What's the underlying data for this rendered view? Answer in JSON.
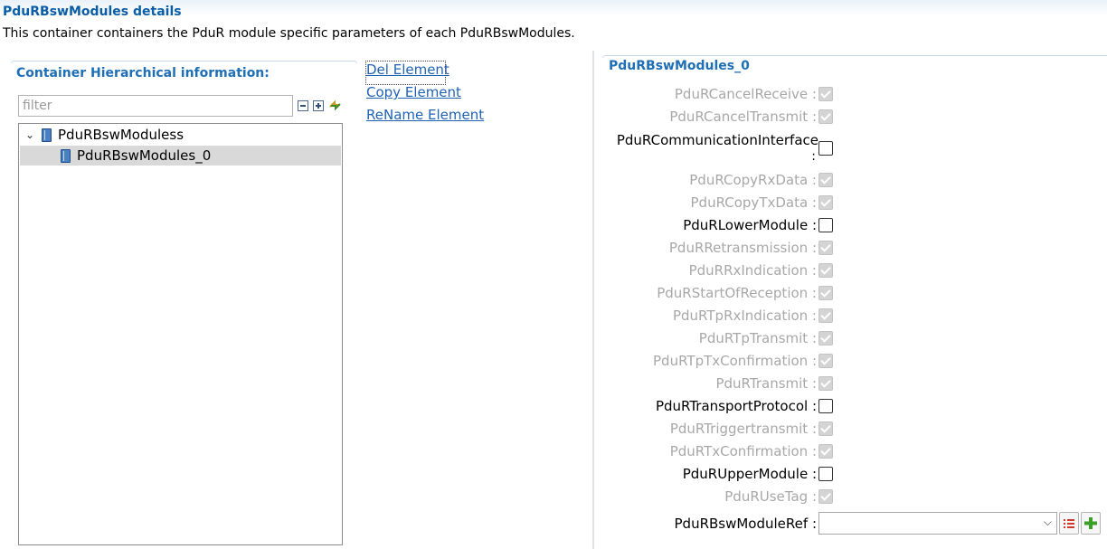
{
  "header": {
    "title": "PduRBswModules details",
    "description": "This container containers the PduR module specific parameters of each PduRBswModules."
  },
  "left_panel": {
    "title": "Container Hierarchical information:",
    "filter_placeholder": "filter",
    "tree": {
      "root_label": "PduRBswModuless",
      "child_label": "PduRBswModules_0"
    }
  },
  "actions": {
    "del": "Del Element",
    "copy": "Copy Element",
    "rename": "ReName Element"
  },
  "right_panel": {
    "title": "PduRBswModules_0",
    "params": [
      {
        "label": "PduRCancelReceive :",
        "checked": true,
        "enabled": false
      },
      {
        "label": "PduRCancelTransmit :",
        "checked": true,
        "enabled": false
      },
      {
        "label": "PduRCommunicationInterface",
        "label2": ":",
        "checked": false,
        "enabled": true
      },
      {
        "label": "PduRCopyRxData :",
        "checked": true,
        "enabled": false
      },
      {
        "label": "PduRCopyTxData :",
        "checked": true,
        "enabled": false
      },
      {
        "label": "PduRLowerModule :",
        "checked": false,
        "enabled": true
      },
      {
        "label": "PduRRetransmission :",
        "checked": true,
        "enabled": false
      },
      {
        "label": "PduRRxIndication :",
        "checked": true,
        "enabled": false
      },
      {
        "label": "PduRStartOfReception :",
        "checked": true,
        "enabled": false
      },
      {
        "label": "PduRTpRxIndication :",
        "checked": true,
        "enabled": false
      },
      {
        "label": "PduRTpTransmit :",
        "checked": true,
        "enabled": false
      },
      {
        "label": "PduRTpTxConfirmation :",
        "checked": true,
        "enabled": false
      },
      {
        "label": "PduRTransmit :",
        "checked": true,
        "enabled": false
      },
      {
        "label": "PduRTransportProtocol :",
        "checked": false,
        "enabled": true
      },
      {
        "label": "PduRTriggertransmit :",
        "checked": true,
        "enabled": false
      },
      {
        "label": "PduRTxConfirmation :",
        "checked": true,
        "enabled": false
      },
      {
        "label": "PduRUpperModule :",
        "checked": false,
        "enabled": true
      },
      {
        "label": "PduRUseTag :",
        "checked": true,
        "enabled": false
      }
    ],
    "ref": {
      "label": "PduRBswModuleRef :",
      "value": ""
    }
  },
  "icons": {
    "collapse_all": "collapse-all-icon",
    "expand_all": "expand-all-icon",
    "sync": "sync-icon",
    "module": "module-book-icon",
    "list": "list-icon",
    "add": "add-plus-icon"
  },
  "colors": {
    "title_blue": "#1e6fb6",
    "link_blue": "#1f63b5",
    "disabled_text": "#a8a8a8",
    "add_green": "#3aa028"
  }
}
